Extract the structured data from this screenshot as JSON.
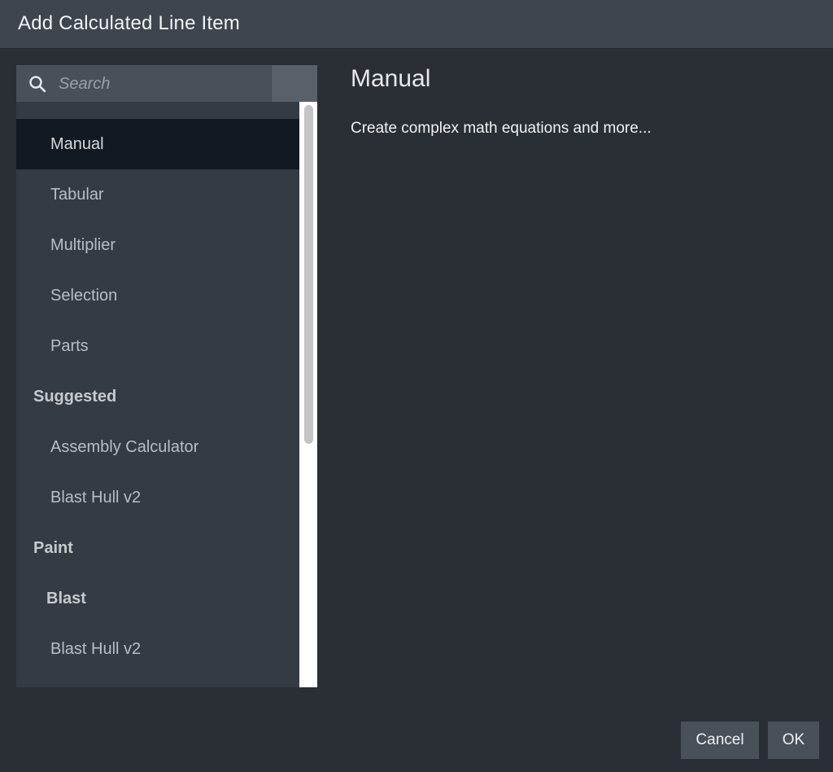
{
  "window": {
    "title": "Add Calculated Line Item"
  },
  "search": {
    "placeholder": "Search",
    "value": ""
  },
  "list": {
    "items": [
      {
        "label": "Manual",
        "level": 2,
        "selected": true
      },
      {
        "label": "Tabular",
        "level": 2,
        "selected": false
      },
      {
        "label": "Multiplier",
        "level": 2,
        "selected": false
      },
      {
        "label": "Selection",
        "level": 2,
        "selected": false
      },
      {
        "label": "Parts",
        "level": 2,
        "selected": false
      },
      {
        "label": "Suggested",
        "level": 0,
        "selected": false
      },
      {
        "label": "Assembly Calculator",
        "level": 2,
        "selected": false
      },
      {
        "label": "Blast Hull v2",
        "level": 2,
        "selected": false
      },
      {
        "label": "Paint",
        "level": 0,
        "selected": false
      },
      {
        "label": "Blast",
        "level": 1,
        "selected": false
      },
      {
        "label": "Blast Hull v2",
        "level": 2,
        "selected": false
      }
    ]
  },
  "detail": {
    "title": "Manual",
    "description": "Create complex math equations and more..."
  },
  "footer": {
    "cancel_label": "Cancel",
    "ok_label": "OK"
  },
  "colors": {
    "background": "#2a2f36",
    "titlebar": "#3e454d",
    "panel": "#353b43",
    "selected_row": "#131920",
    "button": "#4a5058"
  },
  "icons": {
    "search": "search-icon"
  }
}
